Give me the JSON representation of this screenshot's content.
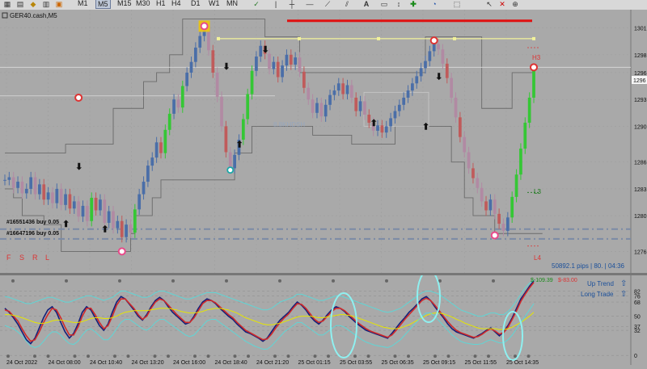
{
  "toolbar": {
    "timeframes": [
      "M1",
      "M5",
      "M15",
      "M30",
      "H1",
      "H4",
      "D1",
      "W1",
      "MN"
    ],
    "selected_timeframe": "M5"
  },
  "main": {
    "symbol_label": "GER40.cash,M5",
    "current_price_label": "1296",
    "side_labels": [
      "H3",
      "L3",
      "L4"
    ],
    "legend_letters": [
      "F",
      "S",
      "R",
      "L"
    ],
    "notes": [
      "#16551436 buy 0.05",
      "#16647196 buy 0.05"
    ],
    "pips_info": "50892.1 pips | 80. | 04:36",
    "faded_label": "8.8KHDSH"
  },
  "chart_data": [
    {
      "type": "line",
      "title": "GER40.cash,M5",
      "y_ticks": [
        1276,
        1280,
        1283,
        1286,
        1290,
        1293,
        1296,
        1298,
        1301
      ],
      "x_ticks": [
        "24 Oct 2022",
        "24 Oct 08:00",
        "24 Oct 10:40",
        "24 Oct 13:20",
        "24 Oct 16:00",
        "24 Oct 18:40",
        "24 Oct 21:20",
        "25 Oct 01:15",
        "25 Oct 03:55",
        "25 Oct 06:35",
        "25 Oct 09:15",
        "25 Oct 11:55",
        "25 Oct 14:35"
      ],
      "ylim": [
        1274.5,
        1302.5
      ],
      "series": [
        {
          "values": [
            1284.0,
            1284.3,
            1283.1,
            1283.8,
            1282.5,
            1283.0,
            1284.3,
            1282.4,
            1283.5,
            1281.8,
            1282.6,
            1281.4,
            1283.0,
            1281.2,
            1282.4,
            1280.8,
            1281.6,
            1279.9,
            1281.1,
            1279.4,
            1282.0,
            1280.6,
            1281.8,
            1279.2,
            1280.5,
            1278.6,
            1279.4,
            1277.6,
            1279.0,
            1278.1,
            1280.7,
            1282.4,
            1283.8,
            1285.6,
            1286.5,
            1288.2,
            1287.0,
            1289.6,
            1291.4,
            1293.0,
            1292.1,
            1294.5,
            1296.0,
            1297.2,
            1298.8,
            1300.1,
            1301.2,
            1298.5,
            1296.0,
            1293.3,
            1290.0,
            1287.1,
            1285.3,
            1286.8,
            1288.5,
            1290.8,
            1293.6,
            1296.2,
            1297.8,
            1299.0,
            1298.1,
            1296.4,
            1297.2,
            1295.5,
            1296.8,
            1298.0,
            1296.9,
            1297.7,
            1296.1,
            1294.3,
            1293.0,
            1291.5,
            1292.6,
            1291.1,
            1292.4,
            1293.5,
            1294.0,
            1294.8,
            1293.6,
            1294.6,
            1293.2,
            1291.7,
            1292.8,
            1291.3,
            1290.4,
            1289.5,
            1290.1,
            1289.3,
            1290.0,
            1290.9,
            1291.7,
            1292.4,
            1293.2,
            1294.0,
            1294.8,
            1295.6,
            1296.5,
            1297.3,
            1298.4,
            1299.2,
            1298.6,
            1297.0,
            1295.4,
            1293.2,
            1291.0,
            1288.8,
            1287.1,
            1285.3,
            1284.2,
            1283.1,
            1281.6,
            1280.6,
            1281.8,
            1280.2,
            1279.1,
            1278.3,
            1279.8,
            1282.1,
            1284.6,
            1287.5,
            1290.4,
            1293.2,
            1296.4
          ],
          "color": "#4a6ea8"
        }
      ],
      "levels": {
        "h3": 1298.8,
        "l3": 1282.6,
        "l4": 1276.6,
        "yellow_line": 1299.8,
        "red_line": 1301.8,
        "support_1": 1278.5,
        "support_2": 1277.4
      },
      "envelope_upper": [
        1287,
        1287,
        1287,
        1287,
        1287,
        1287,
        1287,
        1287,
        1287,
        1287,
        1287,
        1287,
        1287,
        1287,
        1288,
        1288,
        1288,
        1288,
        1288,
        1288,
        1288,
        1288,
        1288,
        1288,
        1288,
        1292,
        1292,
        1292,
        1292,
        1292,
        1292,
        1292,
        1295,
        1295,
        1295,
        1296,
        1296,
        1296,
        1298,
        1298,
        1298,
        1302,
        1302,
        1302,
        1302,
        1302,
        1302,
        1302,
        1302,
        1302,
        1302,
        1302,
        1302,
        1302,
        1302,
        1302,
        1302,
        1302,
        1302,
        1302,
        1300,
        1300,
        1300,
        1300,
        1300,
        1300,
        1300,
        1300,
        1296,
        1296,
        1296,
        1296,
        1296,
        1296,
        1296,
        1296,
        1296,
        1296,
        1296,
        1296,
        1296,
        1296,
        1296,
        1296,
        1296,
        1296,
        1296,
        1296,
        1296,
        1296,
        1296,
        1296,
        1296,
        1296,
        1296,
        1296,
        1296,
        1300,
        1300,
        1300,
        1300,
        1300,
        1300,
        1300,
        1300,
        1300,
        1300,
        1300,
        1300,
        1300,
        1292,
        1292,
        1292,
        1292,
        1292,
        1292,
        1292,
        1296,
        1296,
        1296,
        1296,
        1296,
        1296
      ],
      "envelope_lower": [
        1283,
        1283,
        1282,
        1282,
        1280,
        1280,
        1280,
        1280,
        1280,
        1279,
        1279,
        1279,
        1279,
        1276,
        1276,
        1276,
        1276,
        1276,
        1276,
        1276,
        1276,
        1276,
        1276,
        1276,
        1276,
        1276,
        1276,
        1276,
        1276,
        1278,
        1280,
        1280,
        1280,
        1280,
        1282,
        1282,
        1284,
        1284,
        1284,
        1284,
        1284,
        1284,
        1284,
        1284,
        1284,
        1284,
        1284,
        1284,
        1284,
        1284,
        1284,
        1284,
        1284,
        1287,
        1287,
        1287,
        1287,
        1290,
        1290,
        1290,
        1290,
        1290,
        1290,
        1290,
        1290,
        1290,
        1290,
        1290,
        1290,
        1290,
        1290,
        1289,
        1289,
        1289,
        1289,
        1289,
        1289,
        1289,
        1289,
        1289,
        1288,
        1288,
        1288,
        1288,
        1288,
        1288,
        1288,
        1288,
        1288,
        1288,
        1290,
        1290,
        1290,
        1290,
        1290,
        1290,
        1290,
        1290,
        1290,
        1290,
        1290,
        1290,
        1290,
        1286,
        1286,
        1286,
        1282,
        1282,
        1280,
        1280,
        1280,
        1280,
        1280,
        1278,
        1278,
        1278,
        1278,
        1278,
        1278,
        1278,
        1278,
        1278,
        1278,
        1278,
        1278
      ]
    },
    {
      "type": "line",
      "y_ticks": [
        0,
        82,
        76,
        68,
        50,
        37,
        32
      ],
      "ylim": [
        -5,
        100
      ],
      "labels": {
        "values_text": "$-109.39",
        "values_text_2": "$-83.00",
        "up_trend": "Up Trend",
        "long_trade": "Long Trade"
      },
      "series": [
        {
          "name": "navy",
          "color": "#13207a",
          "values": [
            60,
            55,
            48,
            40,
            30,
            20,
            15,
            22,
            35,
            48,
            58,
            62,
            55,
            42,
            30,
            22,
            28,
            40,
            55,
            62,
            58,
            48,
            38,
            32,
            40,
            55,
            68,
            75,
            72,
            65,
            58,
            50,
            45,
            52,
            62,
            70,
            74,
            70,
            62,
            55,
            50,
            45,
            40,
            42,
            50,
            60,
            68,
            72,
            70,
            66,
            60,
            55,
            50,
            46,
            40,
            35,
            30,
            28,
            25,
            22,
            18,
            22,
            30,
            38,
            45,
            50,
            55,
            62,
            68,
            64,
            58,
            50,
            44,
            40,
            45,
            52,
            58,
            62,
            60,
            56,
            50,
            45,
            40,
            36,
            32,
            30,
            28,
            26,
            24,
            22,
            28,
            35,
            42,
            48,
            55,
            60,
            66,
            72,
            75,
            70,
            62,
            55,
            48,
            40,
            34,
            30,
            28,
            26,
            24,
            22,
            25,
            28,
            32,
            35,
            30,
            25,
            30,
            38,
            48,
            60,
            72,
            80,
            88,
            95
          ]
        },
        {
          "name": "red",
          "color": "#d02a2a",
          "values": [
            58,
            56,
            50,
            44,
            34,
            25,
            18,
            20,
            30,
            42,
            52,
            60,
            58,
            48,
            36,
            26,
            26,
            36,
            50,
            60,
            60,
            52,
            42,
            34,
            38,
            50,
            64,
            72,
            72,
            66,
            60,
            52,
            46,
            50,
            60,
            68,
            72,
            70,
            64,
            58,
            52,
            47,
            42,
            42,
            48,
            57,
            66,
            70,
            70,
            67,
            62,
            57,
            52,
            48,
            42,
            37,
            32,
            29,
            26,
            23,
            20,
            21,
            27,
            35,
            42,
            48,
            53,
            60,
            66,
            65,
            60,
            53,
            46,
            42,
            44,
            50,
            56,
            60,
            60,
            57,
            52,
            47,
            42,
            38,
            34,
            31,
            29,
            27,
            25,
            23,
            26,
            32,
            39,
            46,
            52,
            58,
            64,
            70,
            73,
            70,
            64,
            57,
            50,
            43,
            37,
            32,
            29,
            27,
            25,
            23,
            24,
            27,
            31,
            34,
            31,
            27,
            29,
            36,
            46,
            57,
            69,
            78,
            86,
            93
          ]
        },
        {
          "name": "yellow",
          "color": "#e6e600",
          "values": [
            52,
            52,
            51,
            50,
            48,
            46,
            44,
            42,
            41,
            41,
            42,
            44,
            45,
            45,
            44,
            43,
            42,
            42,
            43,
            45,
            47,
            48,
            48,
            47,
            47,
            48,
            50,
            53,
            55,
            56,
            57,
            57,
            57,
            57,
            58,
            59,
            60,
            60,
            60,
            59,
            58,
            56,
            55,
            54,
            54,
            55,
            56,
            58,
            59,
            60,
            60,
            59,
            58,
            56,
            54,
            51,
            48,
            46,
            44,
            42,
            40,
            39,
            39,
            40,
            41,
            43,
            45,
            47,
            49,
            50,
            50,
            50,
            49,
            48,
            48,
            49,
            50,
            51,
            52,
            52,
            51,
            50,
            48,
            46,
            44,
            42,
            40,
            38,
            36,
            35,
            34,
            34,
            35,
            37,
            39,
            42,
            45,
            48,
            51,
            53,
            54,
            54,
            53,
            51,
            49,
            46,
            44,
            41,
            39,
            37,
            35,
            34,
            34,
            34,
            34,
            33,
            33,
            34,
            36,
            39,
            42,
            46,
            50,
            55
          ]
        },
        {
          "name": "cyan_upper",
          "color": "#5fd6d6",
          "values": [
            75,
            74,
            72,
            70,
            68,
            66,
            66,
            68,
            70,
            72,
            74,
            74,
            72,
            70,
            68,
            68,
            70,
            72,
            74,
            76,
            76,
            74,
            72,
            70,
            72,
            74,
            78,
            82,
            82,
            80,
            78,
            76,
            74,
            74,
            76,
            80,
            82,
            82,
            80,
            78,
            76,
            74,
            72,
            72,
            74,
            76,
            78,
            80,
            80,
            80,
            78,
            76,
            74,
            72,
            70,
            68,
            66,
            64,
            62,
            60,
            58,
            58,
            60,
            64,
            68,
            70,
            72,
            74,
            78,
            78,
            76,
            74,
            72,
            70,
            70,
            72,
            74,
            76,
            76,
            74,
            72,
            70,
            68,
            66,
            64,
            62,
            60,
            58,
            56,
            55,
            56,
            58,
            60,
            64,
            68,
            72,
            76,
            80,
            82,
            82,
            80,
            78,
            74,
            70,
            66,
            62,
            58,
            56,
            54,
            52,
            50,
            50,
            52,
            54,
            54,
            52,
            52,
            56,
            62,
            70,
            78,
            86,
            92,
            96
          ]
        },
        {
          "name": "cyan_lower",
          "color": "#5fd6d6",
          "values": [
            38,
            36,
            34,
            30,
            25,
            18,
            12,
            10,
            12,
            18,
            25,
            30,
            30,
            26,
            20,
            15,
            14,
            18,
            26,
            32,
            34,
            30,
            25,
            20,
            20,
            26,
            34,
            42,
            46,
            46,
            42,
            38,
            34,
            32,
            36,
            42,
            46,
            46,
            42,
            38,
            34,
            30,
            26,
            24,
            26,
            32,
            38,
            44,
            46,
            46,
            42,
            38,
            34,
            30,
            26,
            22,
            18,
            15,
            12,
            10,
            8,
            8,
            12,
            18,
            24,
            30,
            34,
            38,
            42,
            42,
            38,
            34,
            30,
            26,
            26,
            30,
            34,
            38,
            38,
            36,
            32,
            28,
            24,
            20,
            17,
            15,
            13,
            12,
            11,
            10,
            12,
            16,
            20,
            26,
            32,
            38,
            44,
            50,
            54,
            54,
            50,
            44,
            38,
            32,
            26,
            22,
            18,
            16,
            15,
            14,
            14,
            15,
            18,
            20,
            18,
            16,
            16,
            20,
            26,
            34,
            42,
            50,
            58,
            66
          ]
        }
      ]
    }
  ]
}
